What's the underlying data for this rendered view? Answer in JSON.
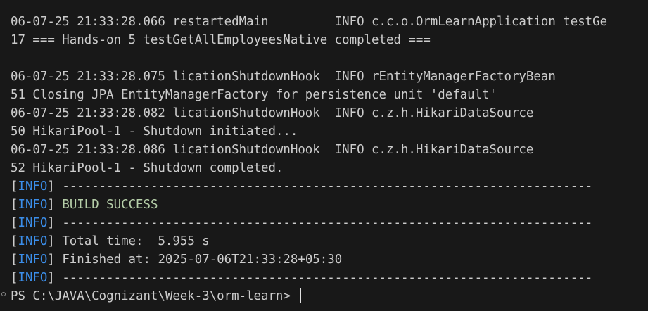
{
  "log": {
    "line1": "06-07-25 21:33:28.066 restartedMain         INFO c.c.o.OrmLearnApplication testGe",
    "line2": "17 === Hands-on 5 testGetAllEmployeesNative completed ===",
    "line4": "06-07-25 21:33:28.075 licationShutdownHook  INFO rEntityManagerFactoryBean",
    "line5": "51 Closing JPA EntityManagerFactory for persistence unit 'default'",
    "line6": "06-07-25 21:33:28.082 licationShutdownHook  INFO c.z.h.HikariDataSource",
    "line7": "50 HikariPool-1 - Shutdown initiated...",
    "line8": "06-07-25 21:33:28.086 licationShutdownHook  INFO c.z.h.HikariDataSource",
    "line9": "52 HikariPool-1 - Shutdown completed."
  },
  "maven": {
    "open_bracket": "[",
    "info_tag": "INFO",
    "close_bracket": "]",
    "separator": " ------------------------------------------------------------------------",
    "build_status": "BUILD SUCCESS",
    "total_time": " Total time:  5.955 s",
    "finished_at": " Finished at: 2025-07-06T21:33:28+05:30"
  },
  "prompt": {
    "text": "PS C:\\JAVA\\Cognizant\\Week-3\\orm-learn> "
  },
  "colors": {
    "background": "#181818",
    "foreground": "#cccccc",
    "info_tag": "#3b8eea",
    "success": "#b5cea8"
  }
}
